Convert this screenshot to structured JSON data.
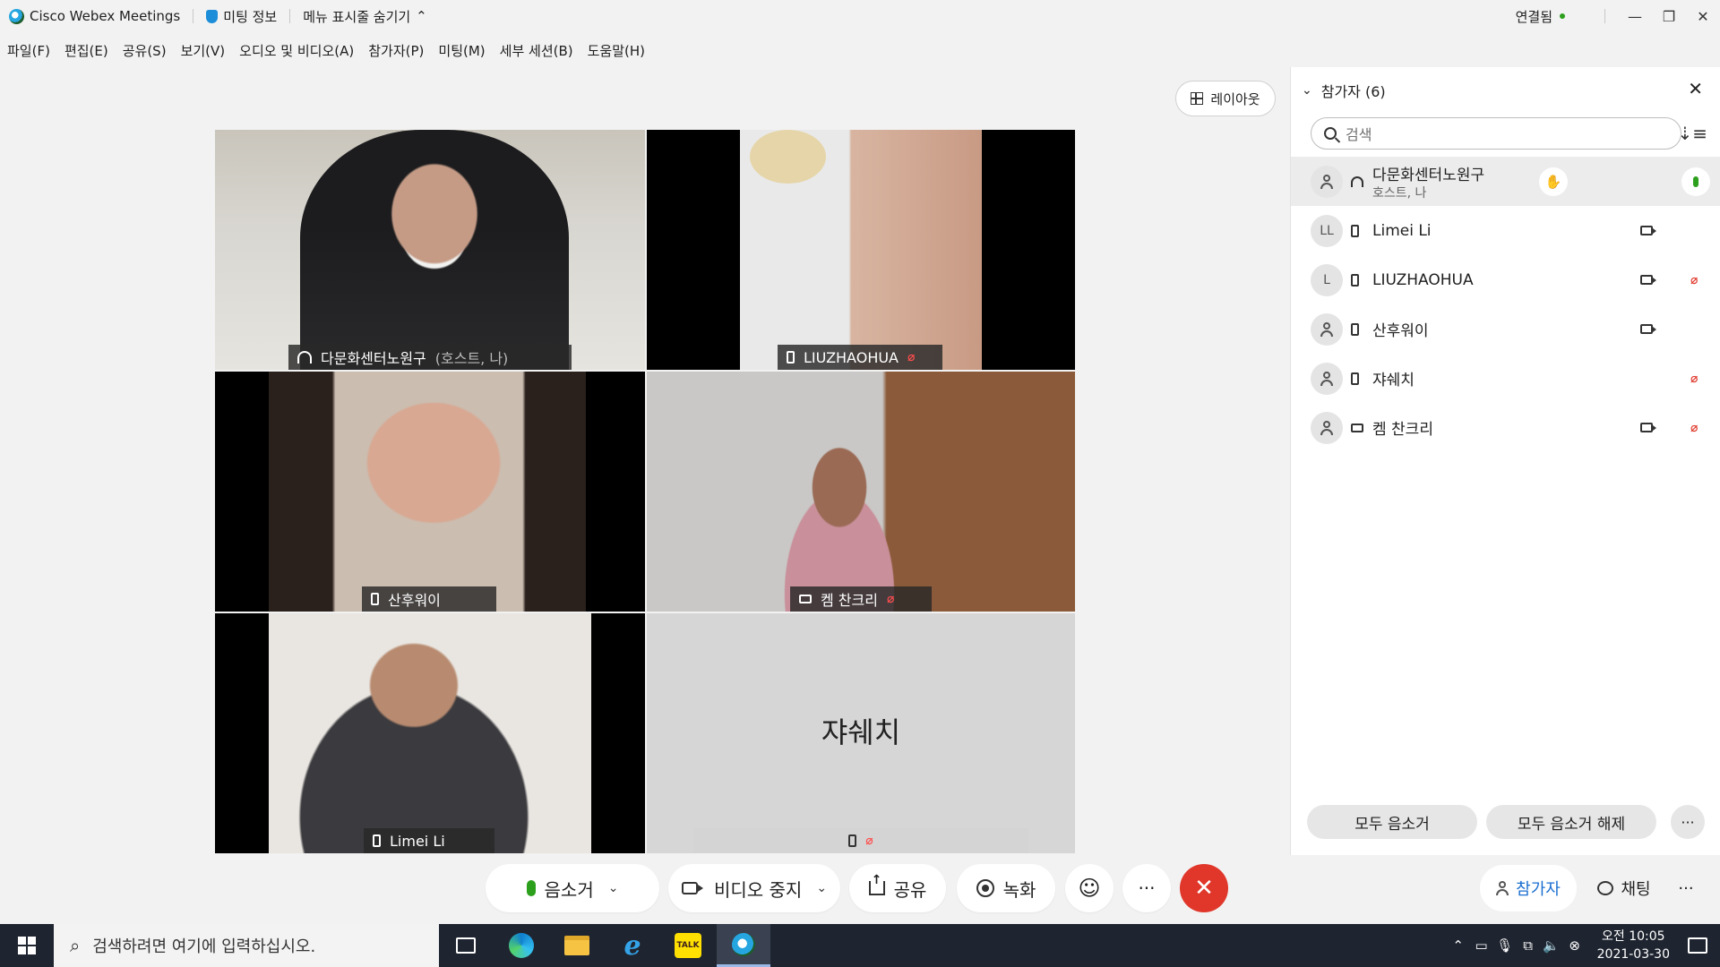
{
  "titlebar": {
    "app_name": "Cisco Webex Meetings",
    "meeting_info": "미팅 정보",
    "hide_menu": "메뉴 표시줄 숨기기",
    "status": "연결됨",
    "status_color": "#2ca01c"
  },
  "menu": [
    "파일(F)",
    "편집(E)",
    "공유(S)",
    "보기(V)",
    "오디오 및 비디오(A)",
    "참가자(P)",
    "미팅(M)",
    "세부 세션(B)",
    "도움말(H)"
  ],
  "layout_button": "레이아웃",
  "tiles": [
    {
      "name": "다문화센터노원구",
      "suffix": "(호스트, 나)",
      "device": "headset-icon",
      "muted": false
    },
    {
      "name": "LIUZHAOHUA",
      "device": "phone-icon",
      "muted": true
    },
    {
      "name": "산후워이",
      "device": "phone-icon",
      "muted": false
    },
    {
      "name": "켐 찬크리",
      "device": "screen-icon",
      "muted": true
    },
    {
      "name": "Limei Li",
      "device": "phone-icon",
      "muted": false
    },
    {
      "name": "쟈쉐치",
      "device": "phone-icon",
      "muted": true,
      "video_off": true
    }
  ],
  "toolbar": {
    "mute": "음소거",
    "stop_video": "비디오 중지",
    "share": "공유",
    "record": "녹화",
    "more": "···",
    "end": "✕"
  },
  "panel": {
    "title": "참가자 (6)",
    "search_placeholder": "검색",
    "participants": [
      {
        "name": "다문화센터노원구",
        "role": "호스트, 나",
        "initials": "",
        "device": "headset-icon",
        "video": false,
        "muted": false,
        "hand": true,
        "mic_active": true
      },
      {
        "name": "Limei Li",
        "role": "",
        "initials": "LL",
        "device": "phone-icon",
        "video": true,
        "muted": false
      },
      {
        "name": "LIUZHAOHUA",
        "role": "",
        "initials": "L",
        "device": "phone-icon",
        "video": true,
        "muted": true
      },
      {
        "name": "산후워이",
        "role": "",
        "initials": "",
        "device": "phone-icon",
        "video": true,
        "muted": false
      },
      {
        "name": "쟈쉐치",
        "role": "",
        "initials": "",
        "device": "phone-icon",
        "video": false,
        "muted": true
      },
      {
        "name": "켐 찬크리",
        "role": "",
        "initials": "",
        "device": "screen-icon",
        "video": true,
        "muted": true
      }
    ],
    "mute_all": "모두 음소거",
    "unmute_all": "모두 음소거 해제",
    "more": "···"
  },
  "bottom_tabs": {
    "participants": "참가자",
    "chat": "채팅",
    "more": "···"
  },
  "taskbar": {
    "search_placeholder": "검색하려면 여기에 입력하십시오.",
    "time": "오전 10:05",
    "date": "2021-03-30"
  }
}
